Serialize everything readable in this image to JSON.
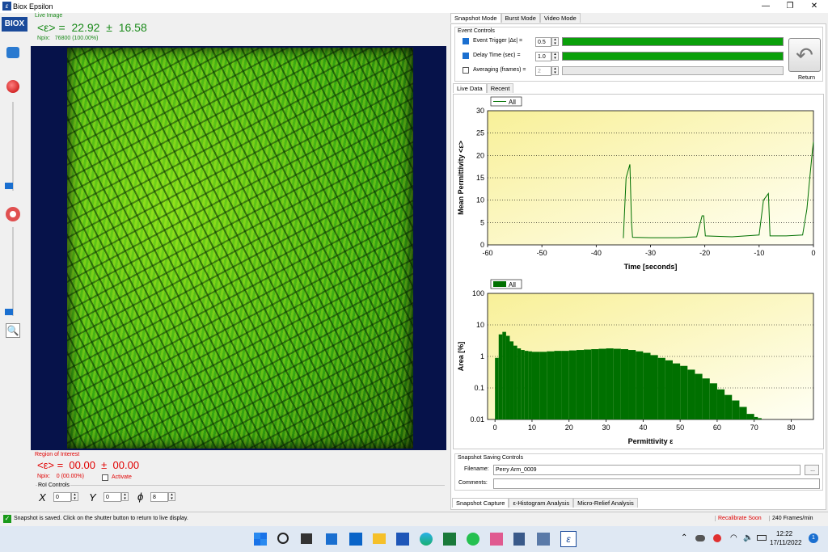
{
  "window": {
    "title": "Biox Epsilon",
    "logo": "BIOX"
  },
  "live": {
    "heading": "Live Image",
    "reading": "<ε> =  22.92  ±  16.58",
    "npix": "Npix:   76800 (100.00%)"
  },
  "roi": {
    "heading": "Region of Interest",
    "reading": "<ε> =  00.00  ±  00.00",
    "npix": "Npix:    0 (00.00%)",
    "activate_label": "Activate",
    "controls_label": "RoI Controls",
    "x_label": "X",
    "x_value": "0",
    "y_label": "Y",
    "y_value": "0",
    "phi_label": "ϕ",
    "phi_value": "8"
  },
  "mode_tabs": [
    "Snapshot Mode",
    "Burst Mode",
    "Video Mode"
  ],
  "event_controls": {
    "heading": "Event Controls",
    "rows": [
      {
        "label": "Event Trigger |Δε| =",
        "value": "0.5",
        "checked": true,
        "bar_fill": 1.0
      },
      {
        "label": "Delay Time (sec) =",
        "value": "1.0",
        "checked": true,
        "bar_fill": 1.0
      },
      {
        "label": "Averaging (frames) =",
        "value": "2",
        "checked": false,
        "bar_fill": 0
      }
    ],
    "return_label": "Return"
  },
  "data_tabs": [
    "Live Data",
    "Recent"
  ],
  "chart_data": [
    {
      "type": "line",
      "legend": [
        "All"
      ],
      "xlabel": "Time [seconds]",
      "ylabel": "Mean Permittivity <ε>",
      "xlim": [
        -60,
        0
      ],
      "ylim": [
        0,
        30
      ],
      "xticks": [
        "-60",
        "-50",
        "-40",
        "-30",
        "-20",
        "-10",
        "0"
      ],
      "yticks": [
        "0",
        "5",
        "10",
        "15",
        "20",
        "25",
        "30"
      ],
      "grid": "horizontal-dotted",
      "series": [
        {
          "name": "All",
          "x": [
            -35,
            -34.5,
            -33.8,
            -33.5,
            -33.3,
            -30,
            -25,
            -21.5,
            -20.5,
            -20.2,
            -19.9,
            -15,
            -10,
            -9.2,
            -8.3,
            -8.0,
            -5,
            -2,
            -1.2,
            -0.6,
            -0.2,
            0
          ],
          "y": [
            1.5,
            15,
            18,
            5,
            1.7,
            1.6,
            1.6,
            1.8,
            6.5,
            6.5,
            2,
            1.8,
            2.2,
            10,
            11.5,
            2,
            2,
            2.2,
            8,
            16,
            21,
            23
          ]
        }
      ]
    },
    {
      "type": "bar",
      "legend": [
        "All"
      ],
      "xlabel": "Permittivity ε",
      "ylabel": "Area [%]",
      "xlim": [
        -2,
        86
      ],
      "ylim": [
        0.01,
        100
      ],
      "yscale": "log",
      "xticks": [
        "0",
        "10",
        "20",
        "30",
        "40",
        "50",
        "60",
        "70",
        "80"
      ],
      "yticks": [
        "0.01",
        "0.1",
        "1",
        "10",
        "100"
      ],
      "grid": "horizontal-dotted",
      "series": [
        {
          "name": "All",
          "x": [
            0,
            1,
            2,
            3,
            4,
            5,
            6,
            7,
            8,
            9,
            10,
            12,
            14,
            16,
            18,
            20,
            22,
            24,
            26,
            28,
            30,
            32,
            34,
            36,
            38,
            40,
            42,
            44,
            46,
            48,
            50,
            52,
            54,
            56,
            58,
            60,
            62,
            64,
            66,
            68,
            70,
            71
          ],
          "y": [
            0.9,
            5,
            6,
            4.5,
            3,
            2.2,
            1.8,
            1.6,
            1.5,
            1.45,
            1.4,
            1.4,
            1.45,
            1.5,
            1.5,
            1.55,
            1.6,
            1.65,
            1.7,
            1.75,
            1.8,
            1.75,
            1.7,
            1.6,
            1.45,
            1.3,
            1.1,
            0.9,
            0.75,
            0.6,
            0.5,
            0.38,
            0.28,
            0.2,
            0.14,
            0.09,
            0.06,
            0.04,
            0.025,
            0.015,
            0.012,
            0.011
          ]
        }
      ]
    }
  ],
  "saving": {
    "heading": "Snapshot Saving Controls",
    "filename_label": "Filename:",
    "filename_value": "Perry Arm_0009",
    "browse_label": "...",
    "comments_label": "Comments:",
    "comments_value": ""
  },
  "bottom_tabs": [
    "Snapshot Capture",
    "ε-Histogram Analysis",
    "Micro-Relief Analysis"
  ],
  "status": {
    "message": "Snapshot is saved. Click on the shutter button to return to live display.",
    "recalibrate": "Recalibrate Soon",
    "fps": "240 Frames/min"
  },
  "taskbar": {
    "time": "12:22",
    "date": "17/11/2022",
    "notif": "1"
  },
  "colors": {
    "accent": "#1a8a1a",
    "roi": "#e00000",
    "bar": "#0aa00a",
    "histo": "#007000"
  }
}
